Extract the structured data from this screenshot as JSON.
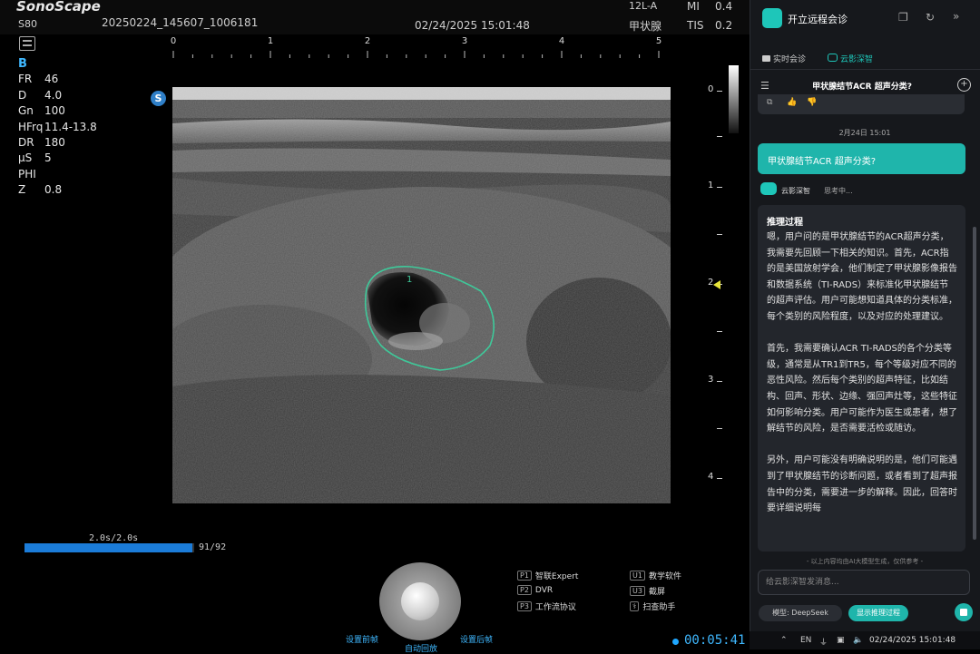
{
  "header": {
    "logo": "SonoScape",
    "model": "S80",
    "patient_id": "20250224_145607_1006181",
    "datetime": "02/24/2025 15:01:48",
    "probe": "12L-A",
    "preset": "甲状腺",
    "mi_label": "MI",
    "mi_value": "0.4",
    "tis_label": "TIS",
    "tis_value": "0.2"
  },
  "ruler_ticks": [
    "0",
    "1",
    "2",
    "3",
    "4",
    "5"
  ],
  "mode": "B",
  "params": [
    {
      "k": "FR",
      "v": "46"
    },
    {
      "k": "D",
      "v": "4.0"
    },
    {
      "k": "Gn",
      "v": "100"
    },
    {
      "k": "HFrq",
      "v": "11.4-13.8"
    },
    {
      "k": "DR",
      "v": "180"
    },
    {
      "k": "μS",
      "v": "5"
    },
    {
      "k": "PHI",
      "v": ""
    },
    {
      "k": "Z",
      "v": "0.8"
    }
  ],
  "probe_marker": "S",
  "roi_label": "1",
  "depth_labels": [
    "0",
    "1",
    "2",
    "3",
    "4"
  ],
  "cine": {
    "time": "2.0s/2.0s",
    "count": "91/92",
    "progress": 0.989
  },
  "wheel": {
    "left": "设置前帧",
    "right": "设置后帧",
    "bottom": "自动回放"
  },
  "softkeys": [
    {
      "tag": "P1",
      "label": "智联Expert"
    },
    {
      "tag": "U1",
      "label": "教学软件"
    },
    {
      "tag": "P2",
      "label": "DVR"
    },
    {
      "tag": "U3",
      "label": "截屏"
    },
    {
      "tag": "P3",
      "label": "工作流协议"
    },
    {
      "tag": "⚕",
      "label": "扫查助手"
    }
  ],
  "timer": "00:05:41",
  "panel": {
    "title": "开立远程会诊",
    "tabs": [
      "实时会诊",
      "云影深智"
    ],
    "chat_title": "甲状腺结节ACR 超声分类?",
    "date_separator": "2月24日 15:01",
    "user_message": "甲状腺结节ACR 超声分类?",
    "bot_name": "云影深智",
    "bot_status": "思考中...",
    "reasoning_title": "推理过程",
    "reasoning_paragraphs": [
      "嗯，用户问的是甲状腺结节的ACR超声分类，我需要先回顾一下相关的知识。首先，ACR指的是美国放射学会，他们制定了甲状腺影像报告和数据系统（TI-RADS）来标准化甲状腺结节的超声评估。用户可能想知道具体的分类标准，每个类别的风险程度，以及对应的处理建议。",
      "首先，我需要确认ACR TI-RADS的各个分类等级，通常是从TR1到TR5，每个等级对应不同的恶性风险。然后每个类别的超声特征，比如结构、回声、形状、边缘、强回声灶等，这些特征如何影响分类。用户可能作为医生或患者，想了解结节的风险，是否需要活检或随访。",
      "另外，用户可能没有明确说明的是，他们可能遇到了甲状腺结节的诊断问题，或者看到了超声报告中的分类，需要进一步的解释。因此，回答时要详细说明每"
    ],
    "disclaimer": "- 以上内容均由AI大模型生成，仅供参考 -",
    "input_placeholder": "给云影深智发消息...",
    "model_button": "模型: DeepSeek",
    "think_button": "显示推理过程"
  },
  "taskbar": {
    "lang": "EN",
    "datetime": "02/24/2025 15:01:48"
  },
  "colors": {
    "accent": "#1fb5ab",
    "blue": "#1b7cd9",
    "roi": "#3ec99a"
  }
}
